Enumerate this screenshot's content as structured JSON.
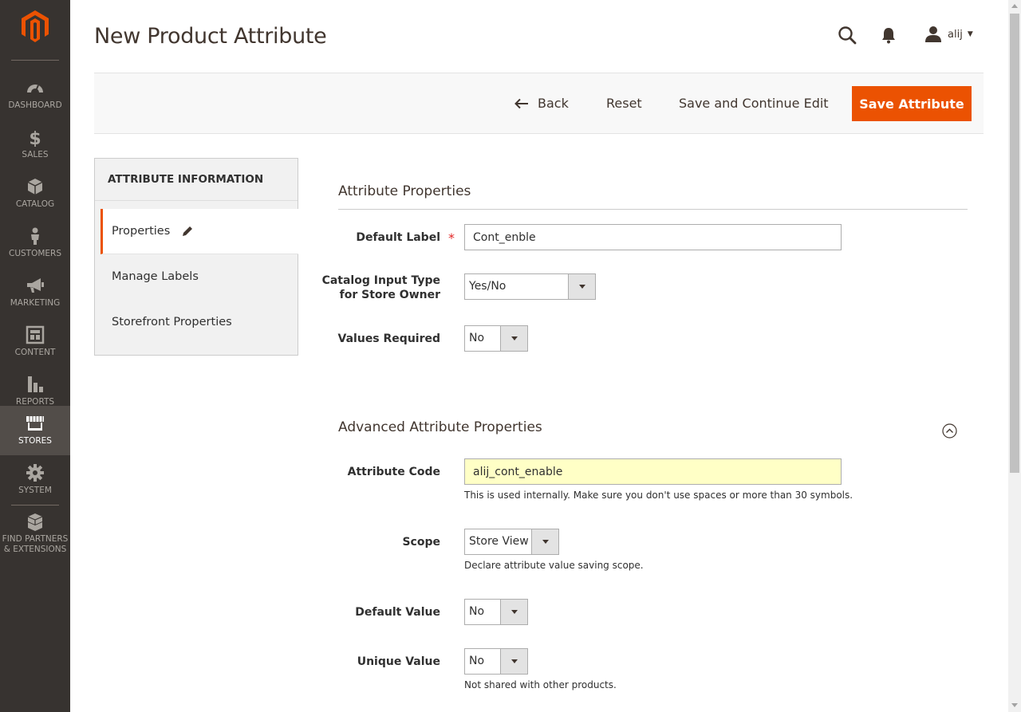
{
  "header": {
    "title": "New Product Attribute",
    "user_name": "alij"
  },
  "sidebar": {
    "items": [
      {
        "label": "Dashboard",
        "icon": "dashboard-icon"
      },
      {
        "label": "Sales",
        "icon": "dollar-icon"
      },
      {
        "label": "Catalog",
        "icon": "box-icon"
      },
      {
        "label": "Customers",
        "icon": "person-icon"
      },
      {
        "label": "Marketing",
        "icon": "megaphone-icon"
      },
      {
        "label": "Content",
        "icon": "layout-icon"
      },
      {
        "label": "Reports",
        "icon": "bar-chart-icon"
      },
      {
        "label": "Stores",
        "icon": "storefront-icon",
        "active": true
      },
      {
        "label": "System",
        "icon": "gear-icon"
      },
      {
        "label": "Find Partners",
        "label2": "& Extensions",
        "icon": "blocks-icon"
      }
    ]
  },
  "actions": {
    "back": "Back",
    "reset": "Reset",
    "save_continue": "Save and Continue Edit",
    "save": "Save Attribute"
  },
  "tabs": {
    "title": "Attribute Information",
    "items": [
      "Properties",
      "Manage Labels",
      "Storefront Properties"
    ]
  },
  "properties": {
    "title": "Attribute Properties",
    "default_label": {
      "label": "Default Label",
      "value": "Cont_enble"
    },
    "input_type": {
      "label_line1": "Catalog Input Type",
      "label_line2": "for Store Owner",
      "value": "Yes/No"
    },
    "values_required": {
      "label": "Values Required",
      "value": "No"
    }
  },
  "advanced": {
    "title": "Advanced Attribute Properties",
    "attribute_code": {
      "label": "Attribute Code",
      "value": "alij_cont_enable",
      "note": "This is used internally. Make sure you don't use spaces or more than 30 symbols."
    },
    "scope": {
      "label": "Scope",
      "value": "Store View",
      "note": "Declare attribute value saving scope."
    },
    "default_value": {
      "label": "Default Value",
      "value": "No"
    },
    "unique_value": {
      "label": "Unique Value",
      "value": "No",
      "note": "Not shared with other products."
    }
  },
  "colors": {
    "accent": "#eb5202",
    "sidebar_bg": "#373330",
    "sidebar_active": "#524d49",
    "highlight_input": "#ffffc6"
  }
}
